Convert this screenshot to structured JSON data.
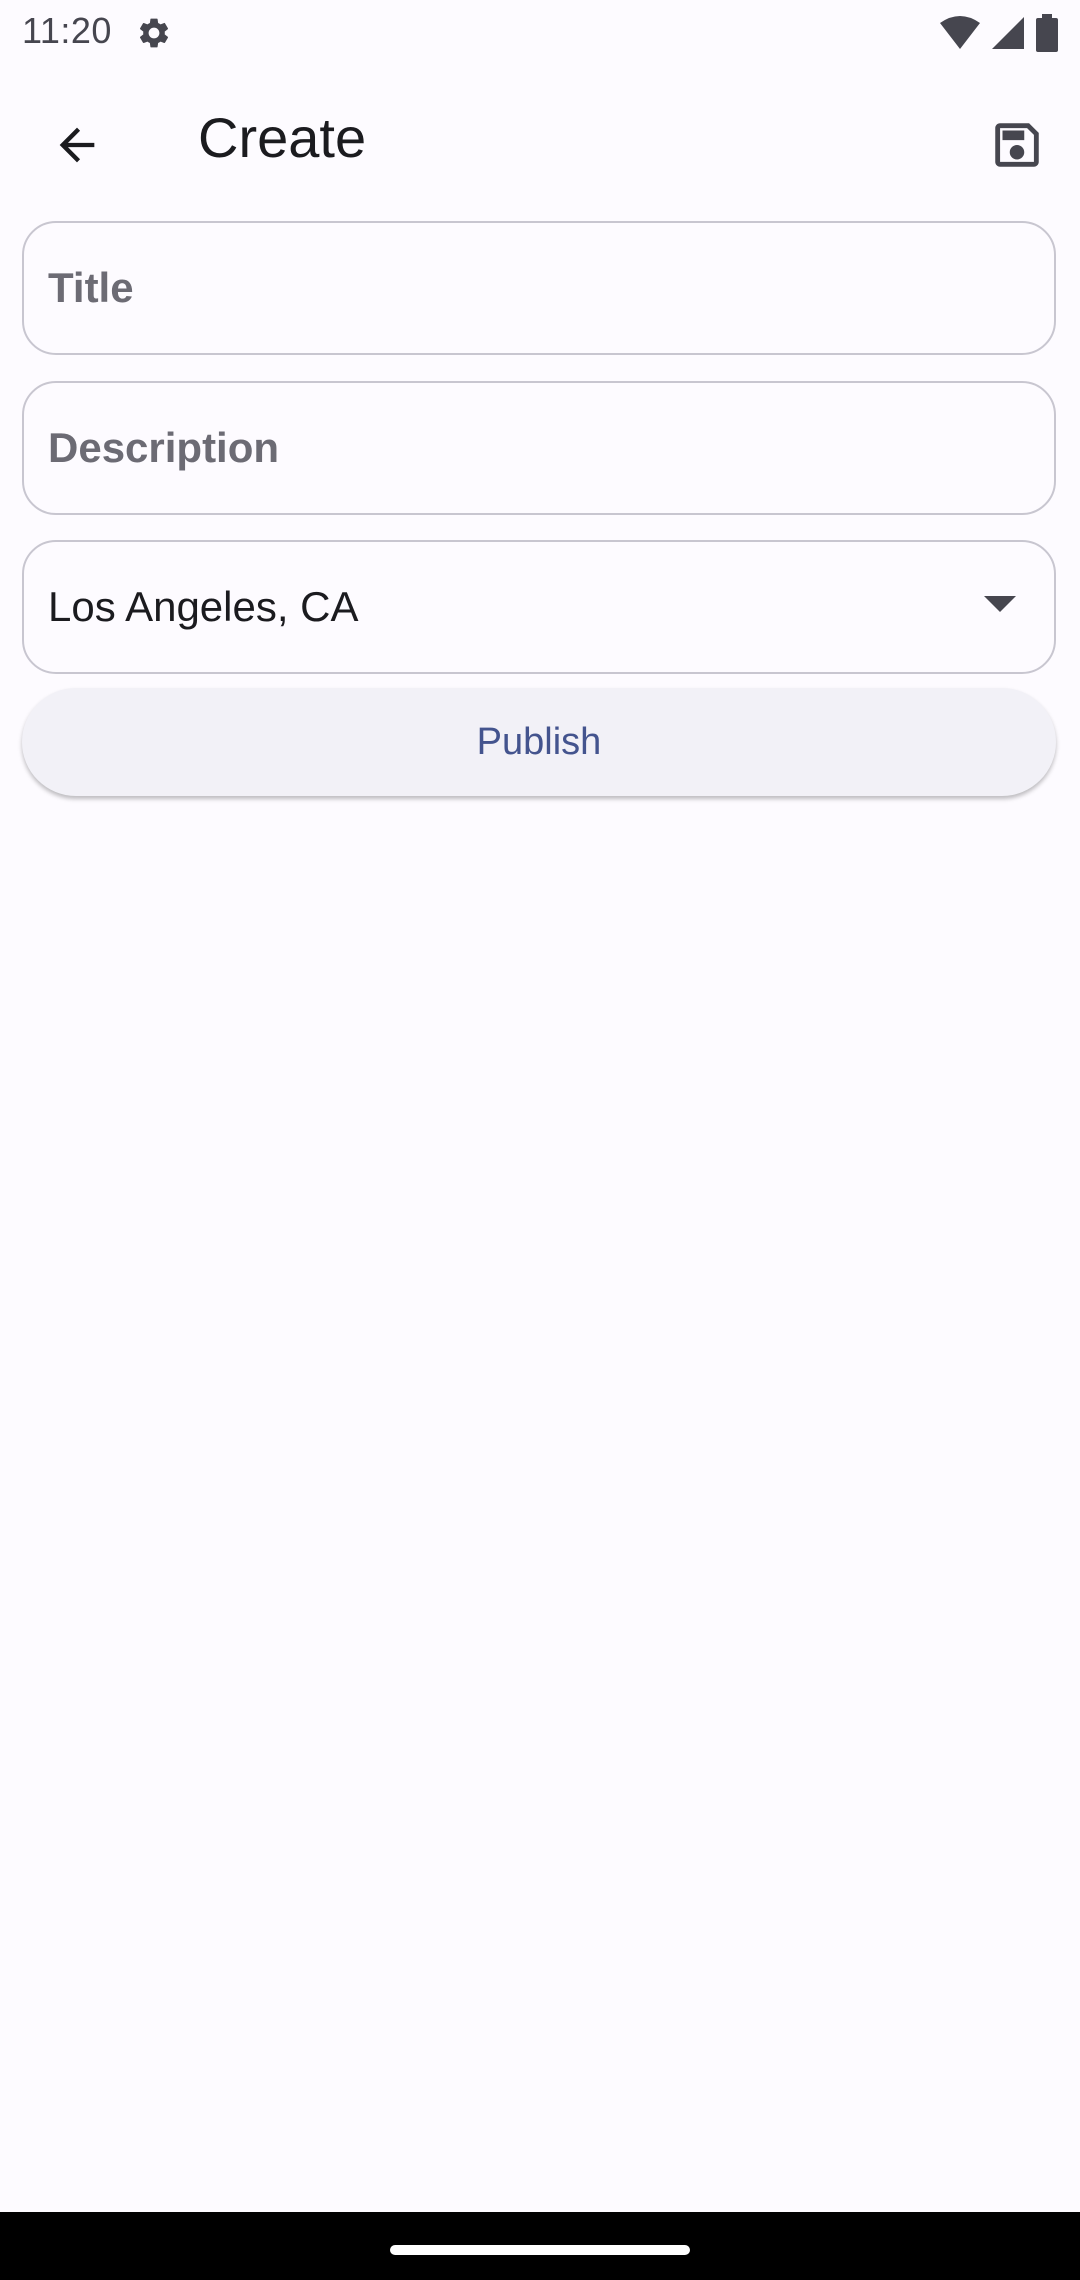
{
  "status_bar": {
    "time": "11:20",
    "icons": [
      "gear-icon",
      "wifi-icon",
      "cell-signal-icon",
      "battery-icon"
    ]
  },
  "app_bar": {
    "title": "Create",
    "back_icon": "arrow-back-icon",
    "save_icon": "save-icon"
  },
  "form": {
    "title_placeholder": "Title",
    "title_value": "",
    "description_placeholder": "Description",
    "description_value": "",
    "location_selected": "Los Angeles, CA",
    "publish_label": "Publish"
  },
  "colors": {
    "background": "#fdfbff",
    "primary_text_button": "#44548e",
    "outline": "#c8c6d0",
    "button_surface": "#f2f1f7"
  }
}
